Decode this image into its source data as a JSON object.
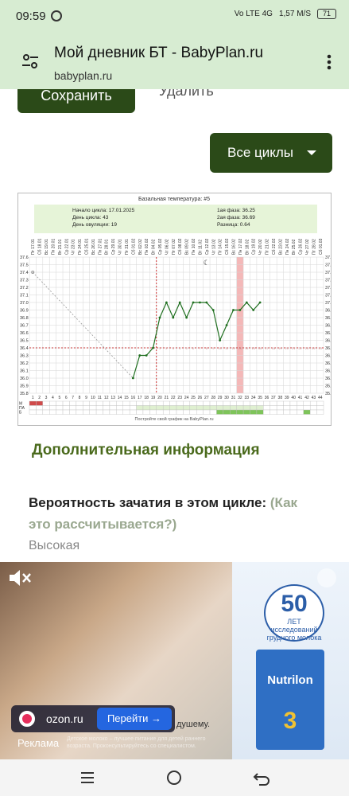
{
  "statusbar": {
    "time": "09:59",
    "network": "Vo LTE 4G",
    "speed": "1,57 M/S",
    "battery": "71"
  },
  "browser": {
    "title": "Мой дневник БТ - BabyPlan.ru",
    "url": "babyplan.ru"
  },
  "page": {
    "save_label": "Сохранить",
    "delete_label": "Удалить",
    "cycles_label": "Все циклы",
    "section_title": "Дополнительная информация",
    "probability_label": "Вероятность зачатия в этом цикле:",
    "probability_link": "(Как это рассчитывается?)",
    "probability_value": "Высокая"
  },
  "chart_data": {
    "type": "line",
    "title": "Базальная температура: #5",
    "info": {
      "start": "Начало цикла: 17.01.2025",
      "day": "День цикла: 43",
      "ovulation_day": "День овуляции: 19",
      "phase1": "1ая фаза: 36.25",
      "phase2": "2ая фаза: 36.69",
      "diff": "Разница: 0.64"
    },
    "dates": [
      "Пт 17.01",
      "Сб 18.01",
      "Вс 19.01",
      "Пн 20.01",
      "Вт 21.01",
      "Ср 22.01",
      "Чт 23.01",
      "Пт 24.01",
      "Сб 25.01",
      "Вс 26.01",
      "Пн 27.01",
      "Вт 28.01",
      "Ср 29.01",
      "Чт 30.01",
      "Пт 31.01",
      "Сб 01.02",
      "Вс 02.02",
      "Пн 03.02",
      "Вт 04.02",
      "Ср 05.02",
      "Чт 06.02",
      "Пт 07.02",
      "Сб 08.02",
      "Вс 09.02",
      "Пн 10.02",
      "Вт 11.02",
      "Ср 12.02",
      "Чт 13.02",
      "Пт 14.02",
      "Сб 15.02",
      "Вс 16.02",
      "Пн 17.02",
      "Вт 18.02",
      "Ср 19.02",
      "Чт 20.02",
      "Пт 21.02",
      "Сб 22.02",
      "Вс 23.02",
      "Пн 24.02",
      "Вт 25.02",
      "Ср 26.02",
      "Чт 27.02",
      "Пт 28.02",
      "Сб 01.03"
    ],
    "x": [
      16,
      17,
      18,
      19,
      20,
      21,
      22,
      23,
      24,
      25,
      26,
      27,
      28,
      29,
      30,
      31,
      32,
      33,
      34,
      35
    ],
    "y": [
      36.0,
      36.3,
      36.3,
      36.4,
      36.8,
      37.0,
      36.8,
      37.0,
      36.8,
      37.0,
      37.0,
      37.0,
      36.9,
      36.5,
      36.7,
      36.9,
      36.9,
      37.0,
      36.9,
      37.0
    ],
    "ylim": [
      35.8,
      37.6
    ],
    "yticks": [
      "37.6",
      "37.5",
      "37.4",
      "37.3",
      "37.2",
      "37.1",
      "37.0",
      "36.9",
      "36.8",
      "36.7",
      "36.6",
      "36.5",
      "36.4",
      "36.3",
      "36.2",
      "36.1",
      "36.0",
      "35.9",
      "35.8"
    ],
    "coverline": 36.4,
    "ovulation_line_day": 19,
    "highlight_day": 32,
    "phase2_labels": [
      "1",
      "2",
      "3",
      "4",
      "5",
      "6",
      "7",
      "8",
      "9",
      "10",
      "11",
      "12",
      "13",
      "14",
      "15",
      "16",
      "17",
      "18",
      "19",
      "20",
      "21",
      "22",
      "23",
      "24",
      "25"
    ],
    "row_labels": [
      "М",
      "ПА",
      "Б"
    ],
    "footer": "Постройте свой график на BabyPlan.ru",
    "colors": {
      "line": "#1f6f1f",
      "cover": "#c00000",
      "highlight": "#f4b8b8",
      "info_bg": "#e6f4d8"
    }
  },
  "ad": {
    "brand": "ozon.ru",
    "cta": "Перейти →",
    "label": "Реклама",
    "caption": "душему.",
    "disclaimer": "Детское молоко – лучшее питание для детей раннего возраста. Проконсультируйтесь со специалистом.",
    "badge_number": "50",
    "badge_unit": "ЛЕТ",
    "badge_text": "исследований грудного молока",
    "product_name": "Nutrilon",
    "product_stage": "3"
  },
  "icons": {
    "whatsapp": "whatsapp-icon",
    "tune": "site-settings-icon",
    "menu": "more-vert-icon",
    "close": "close-icon",
    "mute": "mute-icon"
  }
}
